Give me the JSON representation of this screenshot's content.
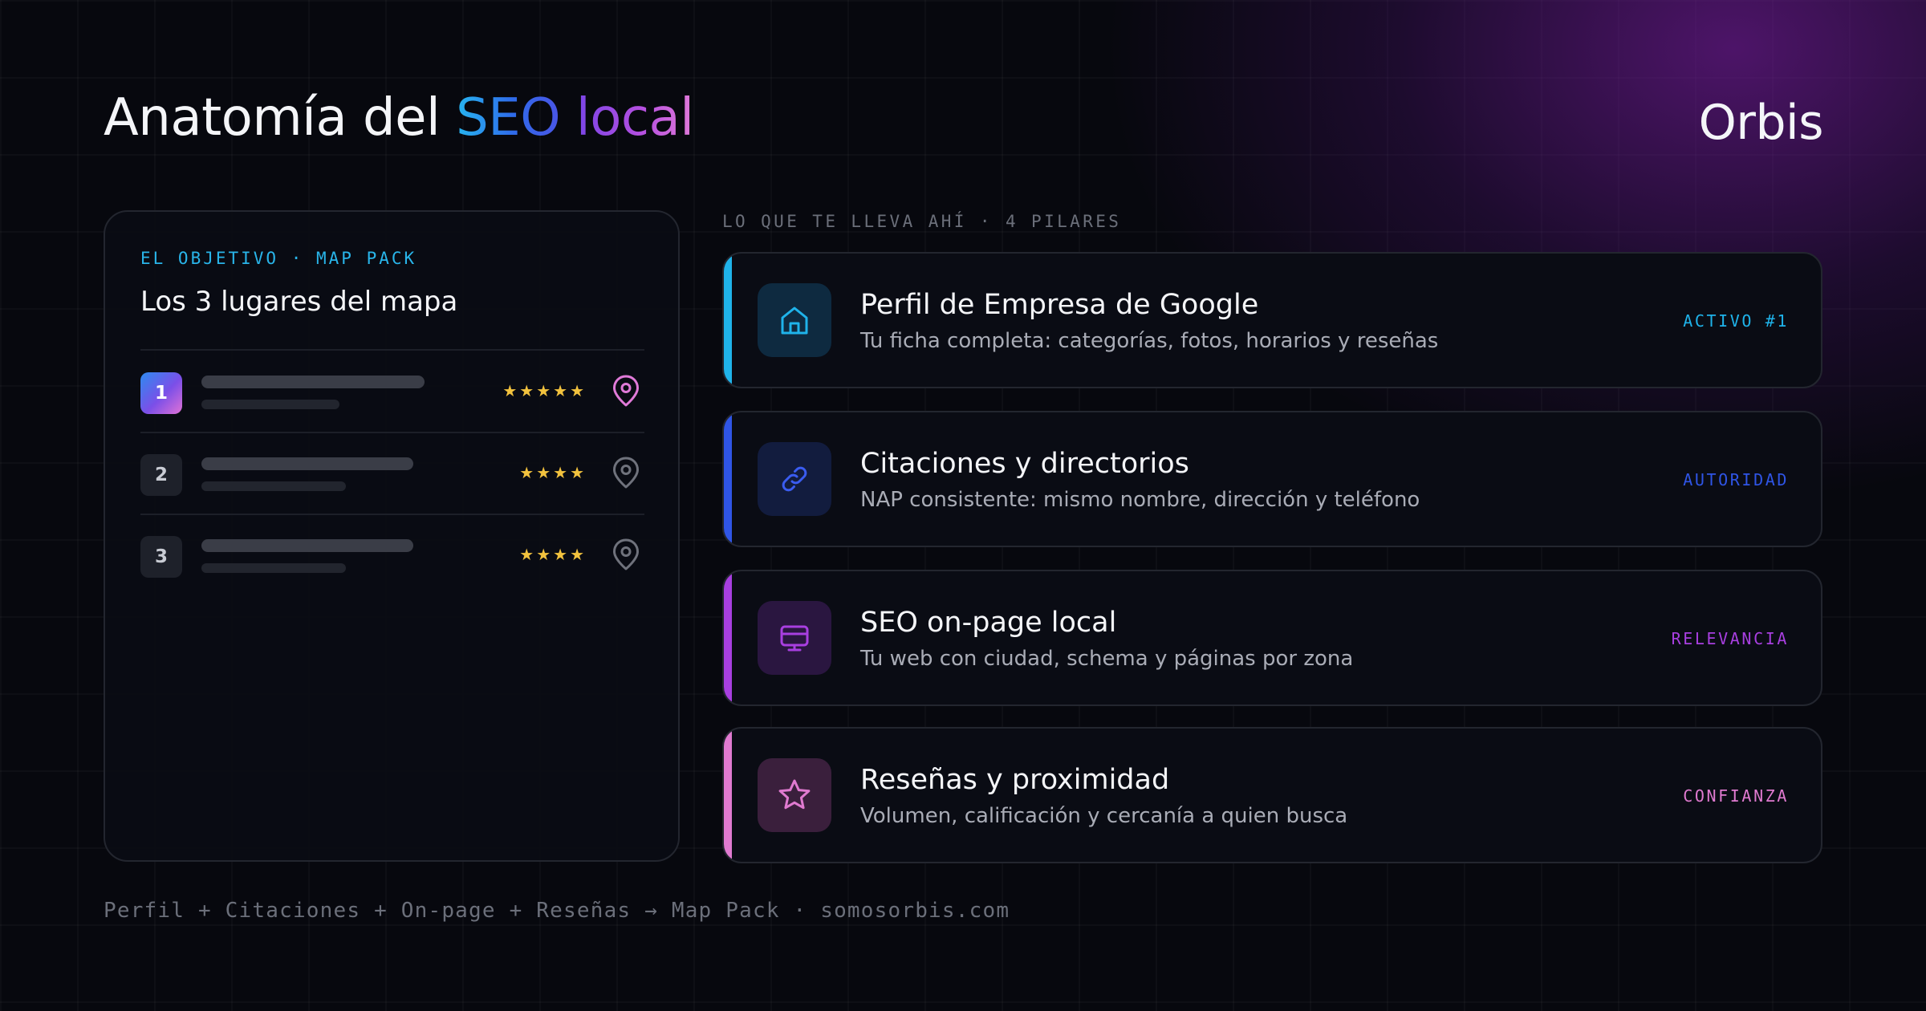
{
  "header": {
    "title_prefix": "Anatomía del",
    "title_highlight_1": "SEO",
    "title_highlight_2": "local",
    "brand": "Orbis"
  },
  "objective": {
    "eyebrow": "EL OBJETIVO · MAP PACK",
    "title": "Los 3 lugares del mapa",
    "rows": [
      {
        "rank": "1",
        "stars": "★★★★★",
        "pin_icon": "map-pin-icon",
        "highlighted": true
      },
      {
        "rank": "2",
        "stars": "★★★★",
        "pin_icon": "map-pin-icon",
        "highlighted": false
      },
      {
        "rank": "3",
        "stars": "★★★★",
        "pin_icon": "map-pin-icon",
        "highlighted": false
      }
    ]
  },
  "pillars_section": {
    "eyebrow": "LO QUE TE LLEVA AHÍ · 4 PILARES",
    "pillars": [
      {
        "icon": "storefront-icon",
        "title": "Perfil de Empresa de Google",
        "description": "Tu ficha completa: categorías, fotos, horarios y reseñas",
        "tag": "ACTIVO #1",
        "color": "#1fb3ea"
      },
      {
        "icon": "link-icon",
        "title": "Citaciones y directorios",
        "description": "NAP consistente: mismo nombre, dirección y teléfono",
        "tag": "AUTORIDAD",
        "color": "#2f55e6"
      },
      {
        "icon": "monitor-icon",
        "title": "SEO on-page local",
        "description": "Tu web con ciudad, schema y páginas por zona",
        "tag": "RELEVANCIA",
        "color": "#a83fe0"
      },
      {
        "icon": "star-icon",
        "title": "Reseñas y proximidad",
        "description": "Volumen, calificación y cercanía a quien busca",
        "tag": "CONFIANZA",
        "color": "#e07ad0"
      }
    ]
  },
  "footer": {
    "text": "Perfil + Citaciones + On-page + Reseñas → Map Pack · somosorbis.com"
  },
  "colors": {
    "background": "#07080e",
    "gold_star": "#f2c23e",
    "pin_highlight": "#e07ad8",
    "pin_muted": "#6f727c"
  }
}
